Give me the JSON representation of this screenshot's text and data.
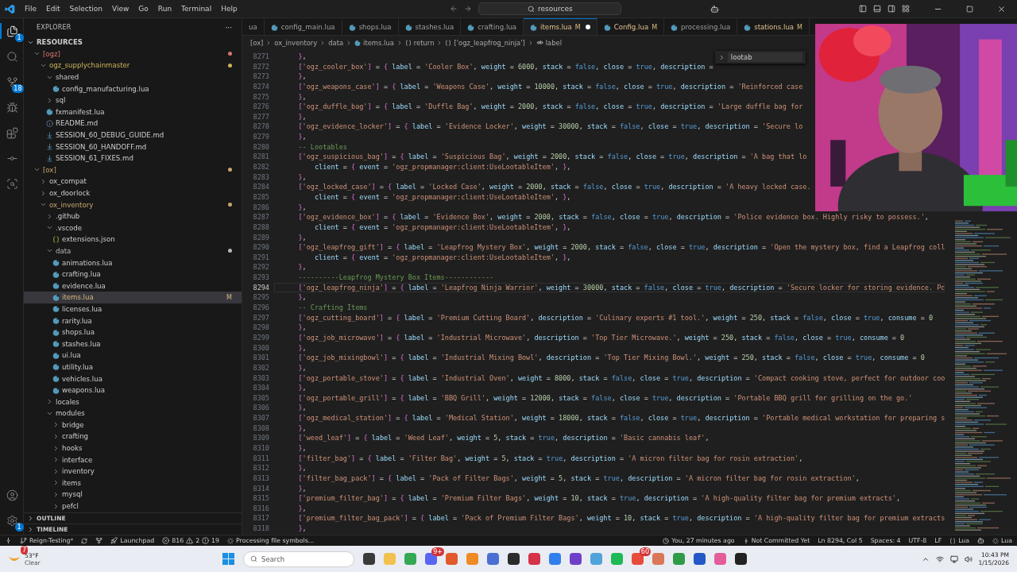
{
  "menu": [
    "File",
    "Edit",
    "Selection",
    "View",
    "Go",
    "Run",
    "Terminal",
    "Help"
  ],
  "command_center": {
    "value": "resources"
  },
  "activity_bar": {
    "top": [
      {
        "badge": "1",
        "selected": true
      },
      {
        "selected": false
      },
      {
        "badge": "18",
        "selected": false
      },
      {
        "selected": false
      },
      {
        "selected": false
      },
      {
        "selected": false
      },
      {
        "selected": false
      }
    ],
    "settings_badge": "1"
  },
  "sidebar": {
    "title": "EXPLORER",
    "more": "···",
    "root": {
      "label": "RESOURCES",
      "expanded": true
    },
    "tree": [
      {
        "kind": "folder",
        "label": "[ogz]",
        "expanded": true,
        "selected": false,
        "color": "#d9756d",
        "children": [
          {
            "kind": "folder",
            "label": "ogz_supplychainmaster",
            "expanded": true,
            "selected": false,
            "color": "#c9b458",
            "children": [
              {
                "kind": "folder",
                "label": "shared",
                "expanded": true,
                "selected": false,
                "children": [
                  {
                    "kind": "lua",
                    "label": "config_manufacturing.lua",
                    "selected": false
                  }
                ]
              },
              {
                "kind": "folder",
                "label": "sql",
                "expanded": false,
                "selected": false
              },
              {
                "kind": "lua",
                "label": "fxmanifest.lua",
                "selected": false
              },
              {
                "kind": "info",
                "label": "README.md",
                "selected": false
              },
              {
                "kind": "markdown",
                "label": "SESSION_60_DEBUG_GUIDE.md",
                "selected": false
              },
              {
                "kind": "markdown",
                "label": "SESSION_60_HANDOFF.md",
                "selected": false
              },
              {
                "kind": "markdown",
                "label": "SESSION_61_FIXES.md",
                "selected": false
              }
            ]
          }
        ]
      },
      {
        "kind": "folder",
        "label": "[ox]",
        "expanded": true,
        "selected": false,
        "color": "#c7a66e",
        "children": [
          {
            "kind": "folder",
            "label": "ox_compat",
            "expanded": false,
            "selected": false
          },
          {
            "kind": "folder",
            "label": "ox_doorlock",
            "expanded": false,
            "selected": false
          },
          {
            "kind": "folder",
            "label": "ox_inventory",
            "expanded": true,
            "selected": false,
            "color": "#c7a66e",
            "children": [
              {
                "kind": "folder",
                "label": ".github",
                "expanded": false,
                "selected": false
              },
              {
                "kind": "folder",
                "label": ".vscode",
                "expanded": true,
                "selected": false,
                "children": [
                  {
                    "kind": "json",
                    "label": "extensions.json",
                    "selected": false
                  }
                ]
              },
              {
                "kind": "folder",
                "label": "data",
                "expanded": true,
                "selected": false,
                "color": "#b8b8b8",
                "children": [
                  {
                    "kind": "lua",
                    "label": "animations.lua",
                    "selected": false
                  },
                  {
                    "kind": "lua",
                    "label": "crafting.lua",
                    "selected": false
                  },
                  {
                    "kind": "lua",
                    "label": "evidence.lua",
                    "selected": false
                  },
                  {
                    "kind": "lua",
                    "label": "items.lua",
                    "selected": true,
                    "badge": "M"
                  },
                  {
                    "kind": "lua",
                    "label": "licenses.lua",
                    "selected": false
                  },
                  {
                    "kind": "lua",
                    "label": "rarity.lua",
                    "selected": false
                  },
                  {
                    "kind": "lua",
                    "label": "shops.lua",
                    "selected": false
                  },
                  {
                    "kind": "lua",
                    "label": "stashes.lua",
                    "selected": false
                  },
                  {
                    "kind": "lua",
                    "label": "ui.lua",
                    "selected": false
                  },
                  {
                    "kind": "lua",
                    "label": "utility.lua",
                    "selected": false
                  },
                  {
                    "kind": "lua",
                    "label": "vehicles.lua",
                    "selected": false
                  },
                  {
                    "kind": "lua",
                    "label": "weapons.lua",
                    "selected": false
                  }
                ]
              },
              {
                "kind": "folder",
                "label": "locales",
                "expanded": false,
                "selected": false
              },
              {
                "kind": "folder",
                "label": "modules",
                "expanded": true,
                "selected": false,
                "children": [
                  {
                    "kind": "folder",
                    "label": "bridge",
                    "expanded": false,
                    "selected": false
                  },
                  {
                    "kind": "folder",
                    "label": "crafting",
                    "expanded": false,
                    "selected": false
                  },
                  {
                    "kind": "folder",
                    "label": "hooks",
                    "expanded": false,
                    "selected": false
                  },
                  {
                    "kind": "folder",
                    "label": "interface",
                    "expanded": false,
                    "selected": false
                  },
                  {
                    "kind": "folder",
                    "label": "inventory",
                    "expanded": false,
                    "selected": false
                  },
                  {
                    "kind": "folder",
                    "label": "items",
                    "expanded": false,
                    "selected": false
                  },
                  {
                    "kind": "folder",
                    "label": "mysql",
                    "expanded": false,
                    "selected": false
                  },
                  {
                    "kind": "folder",
                    "label": "pefcl",
                    "expanded": false,
                    "selected": false
                  }
                ]
              }
            ]
          }
        ]
      }
    ],
    "sections": [
      {
        "label": "OUTLINE",
        "expanded": false
      },
      {
        "label": "TIMELINE",
        "expanded": false
      }
    ]
  },
  "tabs": [
    {
      "kind": "cut",
      "label": "ua",
      "selected": false,
      "modified": false,
      "dirty": false
    },
    {
      "kind": "file",
      "label": "config_main.lua",
      "selected": false,
      "modified": false,
      "dirty": false
    },
    {
      "kind": "file",
      "label": "shops.lua",
      "selected": false,
      "modified": false,
      "dirty": false
    },
    {
      "kind": "file",
      "label": "stashes.lua",
      "selected": false,
      "modified": false,
      "dirty": false
    },
    {
      "kind": "file",
      "label": "crafting.lua",
      "selected": false,
      "modified": false,
      "dirty": false
    },
    {
      "kind": "file",
      "label": "items.lua",
      "selected": true,
      "modified": true,
      "badge": "M",
      "dirty": true
    },
    {
      "kind": "file",
      "label": "Config.lua",
      "selected": false,
      "modified": true,
      "badge": "M",
      "dirty": false
    },
    {
      "kind": "file",
      "label": "processing.lua",
      "selected": false,
      "modified": false,
      "dirty": false
    },
    {
      "kind": "file",
      "label": "stations.lua",
      "selected": false,
      "modified": true,
      "badge": "M",
      "dirty": false
    }
  ],
  "breadcrumb": [
    {
      "label": "[ox]",
      "kind": "folder"
    },
    {
      "label": "ox_inventory",
      "kind": "folder"
    },
    {
      "label": "data",
      "kind": "folder"
    },
    {
      "label": "items.lua",
      "kind": "lua"
    },
    {
      "label": "return",
      "kind": "object"
    },
    {
      "label": "['ogz_leapfrog_ninja']",
      "kind": "object"
    },
    {
      "label": "label",
      "kind": "string"
    }
  ],
  "editor": {
    "find": {
      "value": "lootab"
    },
    "lines": [
      {
        "n": "8271",
        "text": "    },",
        "current": false
      },
      {
        "n": "8272",
        "text": "    ['ogz_cooler_box'] = { label = 'Cooler Box', weight = 6000, stack = false, close = true, description = ",
        "current": false
      },
      {
        "n": "8273",
        "text": "    },",
        "current": false
      },
      {
        "n": "8274",
        "text": "    ['ogz_weapons_case'] = { label = 'Weapons Case', weight = 10000, stack = false, close = true, description = 'Reinforced case",
        "current": false
      },
      {
        "n": "8275",
        "text": "    },",
        "current": false
      },
      {
        "n": "8276",
        "text": "    ['ogz_duffle_bag'] = { label = 'Duffle Bag', weight = 2000, stack = false, close = true, description = 'Large duffle bag for",
        "current": false
      },
      {
        "n": "8277",
        "text": "    },",
        "current": false
      },
      {
        "n": "8278",
        "text": "    ['ogz_evidence_locker'] = { label = 'Evidence Locker', weight = 30000, stack = false, close = true, description = 'Secure lo",
        "current": false
      },
      {
        "n": "8279",
        "text": "    },",
        "current": false
      },
      {
        "n": "8280",
        "text": "    -- Lootables",
        "current": false
      },
      {
        "n": "8281",
        "text": "    ['ogz_suspicious_bag'] = { label = 'Suspicious Bag', weight = 2000, stack = false, close = true, description = 'A bag that lo",
        "current": false
      },
      {
        "n": "8282",
        "text": "        client = { event = 'ogz_propmanager:client:UseLootableItem', },",
        "current": false
      },
      {
        "n": "8283",
        "text": "    },",
        "current": false
      },
      {
        "n": "8284",
        "text": "    ['ogz_locked_case'] = { label = 'Locked Case', weight = 2000, stack = false, close = true, description = 'A heavy locked case.",
        "current": false
      },
      {
        "n": "8285",
        "text": "        client = { event = 'ogz_propmanager:client:UseLootableItem', },",
        "current": false
      },
      {
        "n": "8286",
        "text": "    },",
        "current": false
      },
      {
        "n": "8287",
        "text": "    ['ogz_evidence_box'] = { label = 'Evidence Box', weight = 2000, stack = false, close = true, description = 'Police evidence box. Highly risky to possess.',",
        "current": false
      },
      {
        "n": "8288",
        "text": "        client = { event = 'ogz_propmanager:client:UseLootableItem', },",
        "current": false
      },
      {
        "n": "8289",
        "text": "    },",
        "current": false
      },
      {
        "n": "8290",
        "text": "    ['ogz_leapfrog_gift'] = { label = 'Leapfrog Mystery Box', weight = 2000, stack = false, close = true, description = 'Open the mystery box, find a Leapfrog coll",
        "current": false
      },
      {
        "n": "8291",
        "text": "        client = { event = 'ogz_propmanager:client:UseLootableItem', },",
        "current": false
      },
      {
        "n": "8292",
        "text": "    },",
        "current": false
      },
      {
        "n": "8293",
        "text": "    ----------Leapfrog Mystery Box Items------------",
        "current": false
      },
      {
        "n": "8294",
        "text": "    ['ogz_leapfrog_ninja'] = { label = 'Leapfrog Ninja Warrior', weight = 30000, stack = false, close = true, description = 'Secure locker for storing evidence. Po",
        "current": true
      },
      {
        "n": "8295",
        "text": "    },",
        "current": false
      },
      {
        "n": "8296",
        "text": "    -- Crafting Items",
        "current": false
      },
      {
        "n": "8297",
        "text": "    ['ogz_cutting_board'] = { label = 'Premium Cutting Board', description = 'Culinary experts #1 tool.', weight = 250, stack = false, close = true, consume = 0",
        "current": false
      },
      {
        "n": "8298",
        "text": "    },",
        "current": false
      },
      {
        "n": "8299",
        "text": "    ['ogz_job_microwave'] = { label = 'Industrial Microwave', description = 'Top Tier Microwave.', weight = 250, stack = false, close = true, consume = 0",
        "current": false
      },
      {
        "n": "8300",
        "text": "    },",
        "current": false
      },
      {
        "n": "8301",
        "text": "    ['ogz_job_mixingbowl'] = { label = 'Industrial Mixing Bowl', description = 'Top Tier Mixing Bowl.', weight = 250, stack = false, close = true, consume = 0",
        "current": false
      },
      {
        "n": "8302",
        "text": "    },",
        "current": false
      },
      {
        "n": "8303",
        "text": "    ['ogz_portable_stove'] = { label = 'Industrial Oven', weight = 8000, stack = false, close = true, description = 'Compact cooking stove, perfect for outdoor coo",
        "current": false
      },
      {
        "n": "8304",
        "text": "    },",
        "current": false
      },
      {
        "n": "8305",
        "text": "    ['ogz_portable_grill'] = { label = 'BBQ Grill', weight = 12000, stack = false, close = true, description = 'Portable BBQ grill for grilling on the go.'",
        "current": false
      },
      {
        "n": "8306",
        "text": "    },",
        "current": false
      },
      {
        "n": "8307",
        "text": "    ['ogz_medical_station'] = { label = 'Medical Station', weight = 18000, stack = false, close = true, description = 'Portable medical workstation for preparing s",
        "current": false
      },
      {
        "n": "8308",
        "text": "    },",
        "current": false
      },
      {
        "n": "8309",
        "text": "    ['weed_leaf'] = { label = 'Weed Leaf', weight = 5, stack = true, description = 'Basic cannabis leaf',",
        "current": false
      },
      {
        "n": "8310",
        "text": "    },",
        "current": false
      },
      {
        "n": "8311",
        "text": "    ['filter_bag'] = { label = 'Filter Bag', weight = 5, stack = true, description = 'A micron filter bag for rosin extraction',",
        "current": false
      },
      {
        "n": "8312",
        "text": "    },",
        "current": false
      },
      {
        "n": "8313",
        "text": "    ['filter_bag_pack'] = { label = 'Pack of Filter Bags', weight = 5, stack = true, description = 'A micron filter bag for rosin extraction',",
        "current": false
      },
      {
        "n": "8314",
        "text": "    },",
        "current": false
      },
      {
        "n": "8315",
        "text": "    ['premium_filter_bag'] = { label = 'Premium Filter Bags', weight = 10, stack = true, description = 'A high-quality filter bag for premium extracts',",
        "current": false
      },
      {
        "n": "8316",
        "text": "    },",
        "current": false
      },
      {
        "n": "8317",
        "text": "    ['premium_filter_bag_pack'] = { label = 'Pack of Premium Filter Bags', weight = 10, stack = true, description = 'A high-quality filter bag for premium extracts",
        "current": false
      },
      {
        "n": "8318",
        "text": "    },",
        "current": false
      }
    ]
  },
  "webcam": {
    "kind": "picture"
  },
  "status_bar": {
    "branch": "Reign-Testing*",
    "launchpad": "Launchpad",
    "errors": "816",
    "warnings": "2",
    "infos": "19",
    "progress": "Processing file symbols...",
    "blame": "You, 27 minutes ago",
    "commit": "Not Committed Yet",
    "position": "Ln 8294, Col 5",
    "indent": "Spaces: 4",
    "encoding": "UTF-8",
    "eol": "LF",
    "language": "Lua",
    "server": "Lua"
  },
  "taskbar": {
    "weather": {
      "badge": "7",
      "temperature": "53°F",
      "condition": "Clear"
    },
    "search": {
      "placeholder": "Search"
    },
    "apps": [
      {
        "color": "#3a3a3a"
      },
      {
        "color": "#f2c14e"
      },
      {
        "color": "#34a853"
      },
      {
        "color": "#5865f2",
        "badge": "9+"
      },
      {
        "color": "#e05a2b"
      },
      {
        "color": "#f08a24"
      },
      {
        "color": "#4a6fd4"
      },
      {
        "color": "#2b2b2b"
      },
      {
        "color": "#d6324a"
      },
      {
        "color": "#2f80ed"
      },
      {
        "color": "#6e40c9"
      },
      {
        "color": "#4fa3d9"
      },
      {
        "color": "#1db954"
      },
      {
        "color": "#e84b3c",
        "badge": "60"
      },
      {
        "color": "#d97757"
      },
      {
        "color": "#2e9b48"
      },
      {
        "color": "#2458c6"
      },
      {
        "color": "#e35d9b"
      },
      {
        "color": "#222222"
      }
    ],
    "clock": {
      "time": "10:43 PM",
      "date": "1/15/2026"
    }
  }
}
